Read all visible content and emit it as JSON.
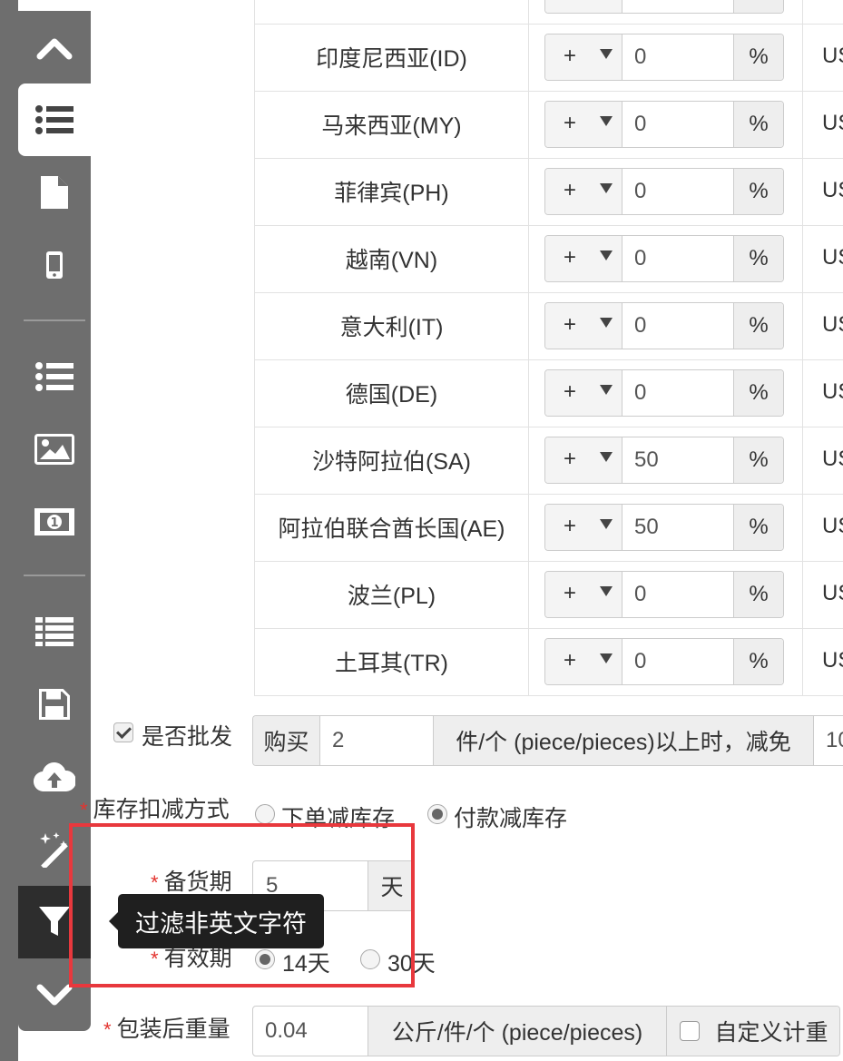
{
  "toolbar": {
    "items": [
      "chevron-up",
      "list",
      "file",
      "mobile",
      "list-ul",
      "image",
      "money",
      "list-alt",
      "save",
      "cloud-upload",
      "magic",
      "filter",
      "chevron-down"
    ]
  },
  "price_table": {
    "rows": [
      {
        "country": "印度尼西亚(ID)",
        "sign": "+",
        "value": "0",
        "unit": "%",
        "currency": "US"
      },
      {
        "country": "马来西亚(MY)",
        "sign": "+",
        "value": "0",
        "unit": "%",
        "currency": "US"
      },
      {
        "country": "菲律宾(PH)",
        "sign": "+",
        "value": "0",
        "unit": "%",
        "currency": "US"
      },
      {
        "country": "越南(VN)",
        "sign": "+",
        "value": "0",
        "unit": "%",
        "currency": "US"
      },
      {
        "country": "意大利(IT)",
        "sign": "+",
        "value": "0",
        "unit": "%",
        "currency": "US"
      },
      {
        "country": "德国(DE)",
        "sign": "+",
        "value": "0",
        "unit": "%",
        "currency": "US"
      },
      {
        "country": "沙特阿拉伯(SA)",
        "sign": "+",
        "value": "50",
        "unit": "%",
        "currency": "US"
      },
      {
        "country": "阿拉伯联合酋长国(AE)",
        "sign": "+",
        "value": "50",
        "unit": "%",
        "currency": "US"
      },
      {
        "country": "波兰(PL)",
        "sign": "+",
        "value": "0",
        "unit": "%",
        "currency": "US"
      },
      {
        "country": "土耳其(TR)",
        "sign": "+",
        "value": "0",
        "unit": "%",
        "currency": "US"
      }
    ]
  },
  "wholesale": {
    "label": "是否批发",
    "checked": true,
    "buy_label": "购买",
    "quantity": "2",
    "suffix": "件/个 (piece/pieces)以上时，减免",
    "discount": "10"
  },
  "stock": {
    "label": "库存扣减方式",
    "option1": "下单减库存",
    "option2": "付款减库存",
    "selected": "付款减库存"
  },
  "prep": {
    "label": "备货期",
    "value": "5",
    "unit": "天"
  },
  "validity": {
    "label": "有效期",
    "option1": "14天",
    "option2": "30天",
    "selected": "14天"
  },
  "weight": {
    "label": "包装后重量",
    "value": "0.04",
    "unit": "公斤/件/个 (piece/pieces)",
    "custom_label": "自定义计重"
  },
  "tooltip": {
    "text": "过滤非英文字符"
  },
  "colors": {
    "toolbar": "#6e6e6e",
    "active_tool": "#2d2d2d",
    "highlight": "#e8383d",
    "required": "#e3342f"
  }
}
